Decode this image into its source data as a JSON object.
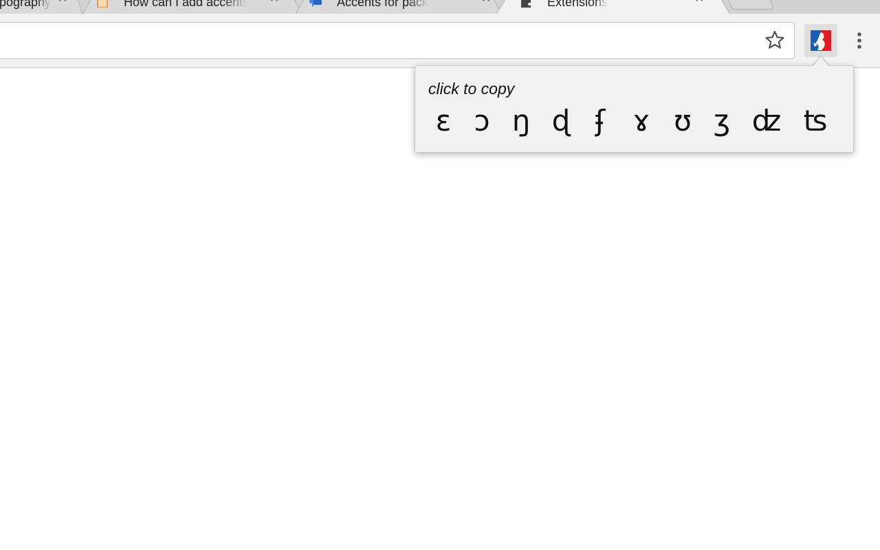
{
  "browser": {
    "tabs": [
      {
        "title": "Typography",
        "icon": "page-icon",
        "active": false
      },
      {
        "title": "How can I add accents",
        "icon": "document-icon",
        "active": false
      },
      {
        "title": "Accents for pack",
        "icon": "chat-icon",
        "active": false
      },
      {
        "title": "Extensions",
        "icon": "puzzle-icon",
        "active": true
      }
    ],
    "close_glyph": "✕"
  },
  "toolbar": {
    "bookmark_icon": "star-icon",
    "extension_icon": "ipa-extension-icon",
    "menu_icon": "kebab-menu-icon"
  },
  "popup": {
    "hint": "click to copy",
    "symbols": [
      "ɛ",
      "ɔ",
      "ŋ",
      "ɖ",
      "ʄ",
      "ɤ",
      "ʊ",
      "ʒ",
      "ʣ",
      "ʦ"
    ]
  },
  "colors": {
    "accent_blue": "#1a5fb4",
    "accent_red": "#e01b24"
  }
}
